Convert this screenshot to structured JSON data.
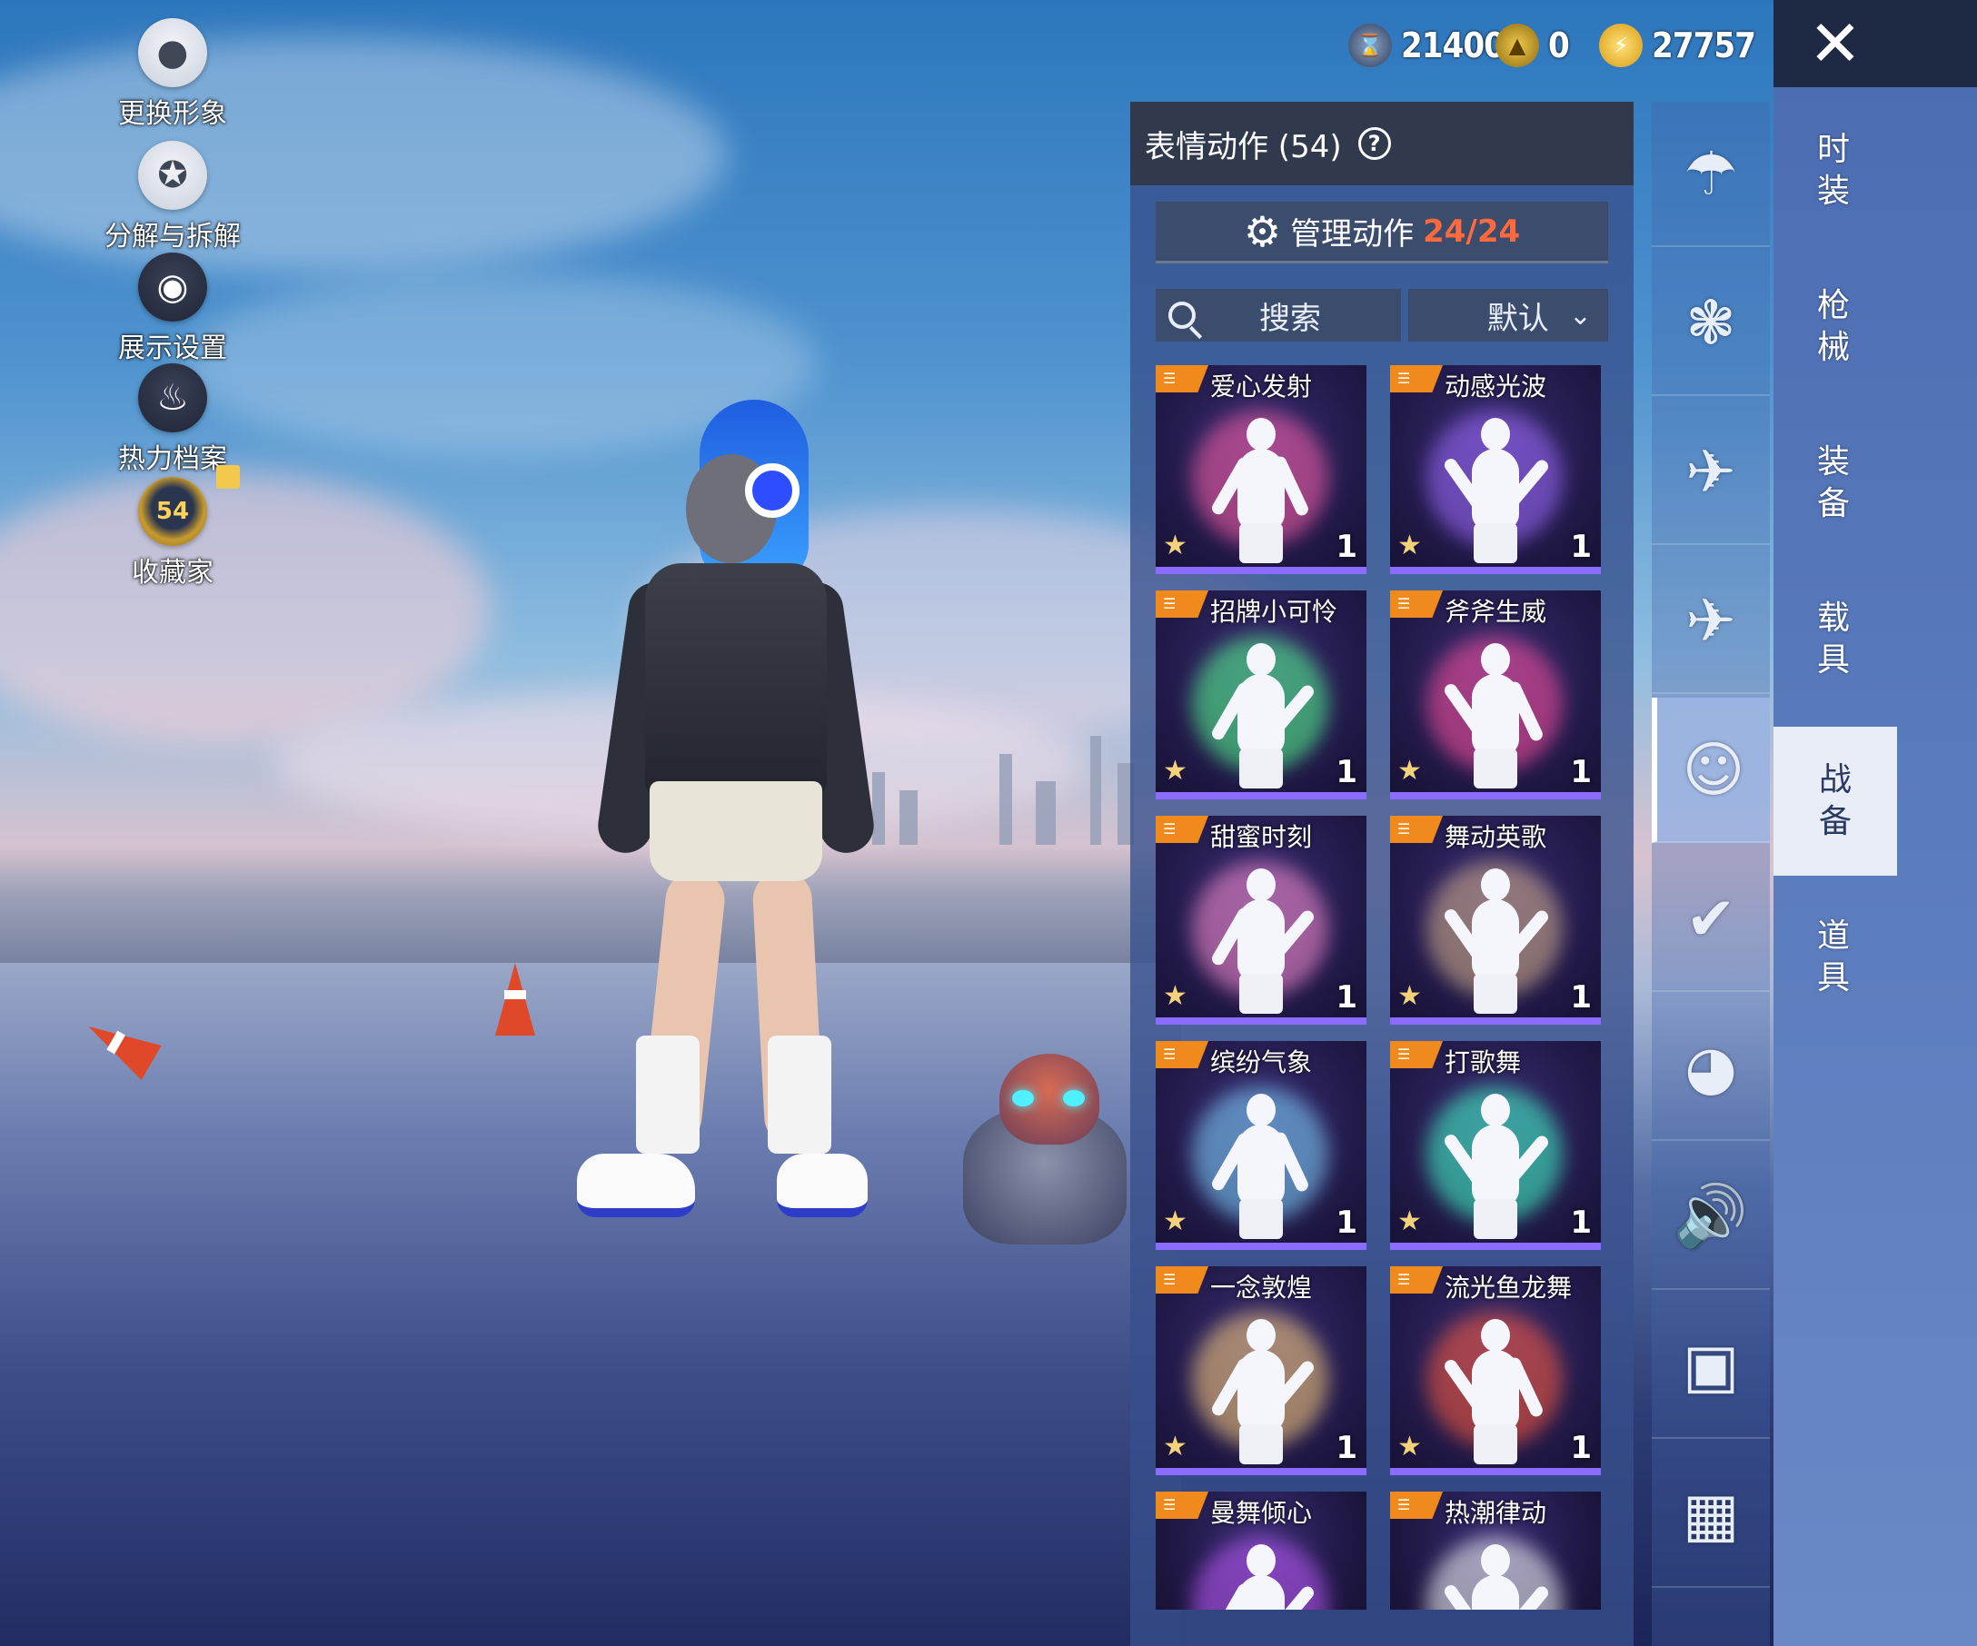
{
  "left_menu": {
    "items": [
      {
        "label": "更换形象",
        "icon": "person-icon"
      },
      {
        "label": "分解与拆解",
        "icon": "puzzle-icon"
      },
      {
        "label": "展示设置",
        "icon": "eye-icon"
      },
      {
        "label": "热力档案",
        "icon": "flame-icon"
      },
      {
        "label": "收藏家",
        "icon": "collector-badge-icon",
        "badge_value": "54"
      }
    ]
  },
  "currency": {
    "silver": "21400",
    "gold": "0",
    "energy": "27757"
  },
  "categories": [
    {
      "label": "时装"
    },
    {
      "label": "枪械"
    },
    {
      "label": "装备"
    },
    {
      "label": "载具"
    },
    {
      "label": "战备",
      "active": true
    },
    {
      "label": "道具"
    }
  ],
  "subcategories": [
    {
      "icon": "parachute-icon"
    },
    {
      "icon": "skydive-icon"
    },
    {
      "icon": "airplane-trail-icon"
    },
    {
      "icon": "airplane-icon"
    },
    {
      "icon": "emote-face-icon",
      "active": true
    },
    {
      "icon": "glider-icon"
    },
    {
      "icon": "robot-icon"
    },
    {
      "icon": "speaker-icon"
    },
    {
      "icon": "chat-sticker-icon"
    },
    {
      "icon": "gallery-icon"
    }
  ],
  "emote_panel": {
    "title": "表情动作 (54)",
    "manage_label": "管理动作",
    "manage_count": "24/24",
    "search_label": "搜索",
    "sort_label": "默认",
    "cards": [
      {
        "title": "爱心发射",
        "count": "1",
        "glow": "#ff5fa8"
      },
      {
        "title": "动感光波",
        "count": "1",
        "glow": "#a06bff"
      },
      {
        "title": "招牌小可怜",
        "count": "1",
        "glow": "#54ff8c"
      },
      {
        "title": "斧斧生威",
        "count": "1",
        "glow": "#ff4f9e"
      },
      {
        "title": "甜蜜时刻",
        "count": "1",
        "glow": "#ff8fd0"
      },
      {
        "title": "舞动英歌",
        "count": "1",
        "glow": "#d9b48a"
      },
      {
        "title": "缤纷气象",
        "count": "1",
        "glow": "#7fd6ff"
      },
      {
        "title": "打歌舞",
        "count": "1",
        "glow": "#40ffc8"
      },
      {
        "title": "一念敦煌",
        "count": "1",
        "glow": "#ffd27a"
      },
      {
        "title": "流光鱼龙舞",
        "count": "1",
        "glow": "#ff5a3a"
      },
      {
        "title": "曼舞倾心",
        "count": "",
        "glow": "#c25bff"
      },
      {
        "title": "热潮律动",
        "count": "",
        "glow": "#ffffff"
      }
    ]
  }
}
